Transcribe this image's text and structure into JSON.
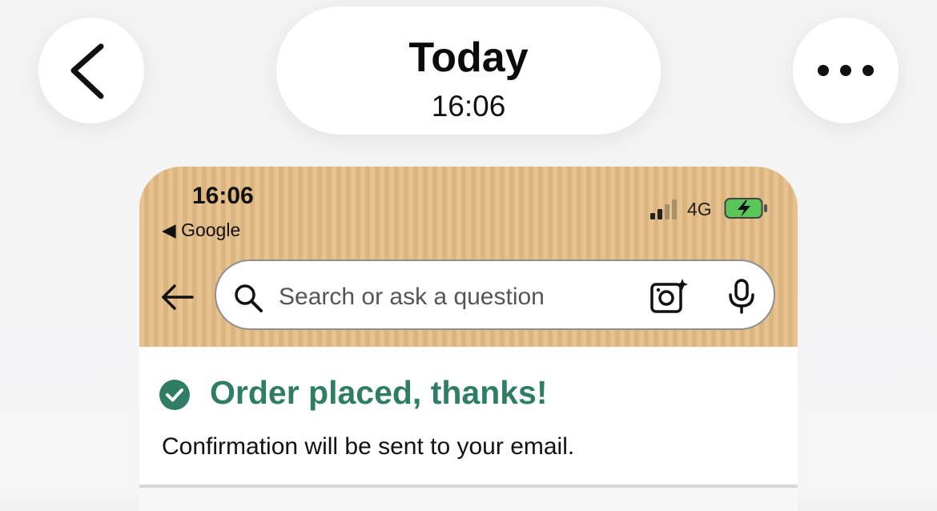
{
  "viewer": {
    "title": "Today",
    "time": "16:06"
  },
  "status_bar": {
    "time": "16:06",
    "back_app": "◀ Google",
    "network": "4G"
  },
  "search": {
    "placeholder": "Search or ask a question"
  },
  "order": {
    "title": "Order placed, thanks!",
    "subtitle": "Confirmation will be sent to your email."
  },
  "colors": {
    "header_bg": "#e4bb85",
    "accent_green": "#2e7d64",
    "battery_green": "#5ac65a"
  },
  "icons": [
    "chevron-left-icon",
    "more-dots-icon",
    "signal-icon",
    "battery-charging-icon",
    "arrow-left-icon",
    "search-icon",
    "camera-sparkle-icon",
    "microphone-icon",
    "check-circle-icon"
  ]
}
